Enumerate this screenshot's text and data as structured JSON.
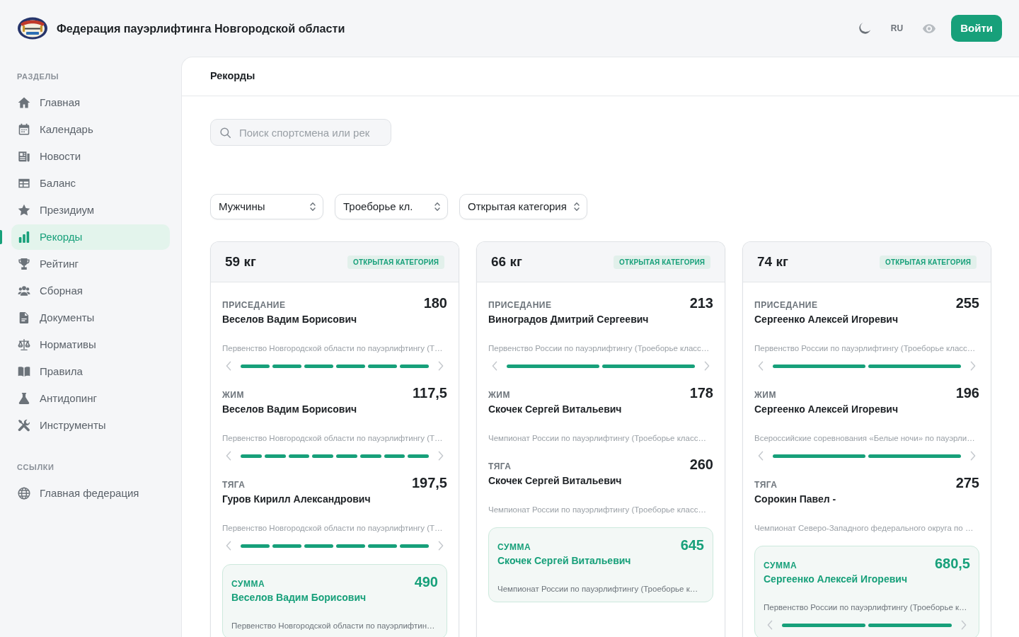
{
  "header": {
    "title": "Федерация пауэрлифтинга Новгородской области",
    "language": "RU",
    "login_button": "Войти"
  },
  "sidebar": {
    "sections": [
      {
        "title": "РАЗДЕЛЫ",
        "items": [
          {
            "label": "Главная",
            "selected": false
          },
          {
            "label": "Календарь",
            "selected": false
          },
          {
            "label": "Новости",
            "selected": false
          },
          {
            "label": "Баланс",
            "selected": false
          },
          {
            "label": "Президиум",
            "selected": false
          },
          {
            "label": "Рекорды",
            "selected": true
          },
          {
            "label": "Рейтинг",
            "selected": false
          },
          {
            "label": "Сборная",
            "selected": false
          },
          {
            "label": "Документы",
            "selected": false
          },
          {
            "label": "Нормативы",
            "selected": false
          },
          {
            "label": "Правила",
            "selected": false
          },
          {
            "label": "Антидопинг",
            "selected": false
          },
          {
            "label": "Инструменты",
            "selected": false
          }
        ]
      },
      {
        "title": "ССЫЛКИ",
        "items": [
          {
            "label": "Главная федерация",
            "selected": false
          }
        ]
      }
    ]
  },
  "page": {
    "title": "Рекорды",
    "search": {
      "placeholder": "Поиск спортсмена или рек"
    },
    "filters": [
      {
        "value": "Мужчины"
      },
      {
        "value": "Троеборье кл."
      },
      {
        "value": "Открытая категория"
      }
    ],
    "cards": [
      {
        "weight_class": "59 кг",
        "badge": "ОТКРЫТАЯ КАТЕГОРИЯ",
        "records": [
          {
            "lift": "ПРИСЕДАНИЕ",
            "result": "180",
            "athlete": "Веселов Вадим Борисович",
            "competition": "Первенство Новгородской области по пауэрлифтингу (Т…",
            "slides": [
              {
                "kind": "bar"
              },
              {
                "kind": "bar"
              },
              {
                "kind": "bar"
              },
              {
                "kind": "bar"
              },
              {
                "kind": "bar"
              },
              {
                "kind": "bar"
              }
            ]
          },
          {
            "lift": "ЖИМ",
            "result": "117,5",
            "athlete": "Веселов Вадим Борисович",
            "competition": "Первенство Новгородской области по пауэрлифтингу (Т…",
            "slides": [
              {
                "kind": "bar"
              },
              {
                "kind": "bar"
              },
              {
                "kind": "bar"
              },
              {
                "kind": "bar"
              },
              {
                "kind": "bar"
              },
              {
                "kind": "bar"
              },
              {
                "kind": "bar"
              },
              {
                "kind": "bar"
              }
            ]
          },
          {
            "lift": "ТЯГА",
            "result": "197,5",
            "athlete": "Гуров Кирилл Александрович",
            "competition": "Первенство Новгородской области по пауэрлифтингу (Т…",
            "slides": [
              {
                "kind": "bar"
              },
              {
                "kind": "bar"
              },
              {
                "kind": "bar"
              },
              {
                "kind": "bar"
              },
              {
                "kind": "bar"
              },
              {
                "kind": "bar"
              }
            ]
          }
        ],
        "total": {
          "label": "СУММА",
          "result": "490",
          "athlete": "Веселов Вадим Борисович",
          "competition": "Первенство Новгородской области по пауэрлифтин…"
        }
      },
      {
        "weight_class": "66 кг",
        "badge": "ОТКРЫТАЯ КАТЕГОРИЯ",
        "records": [
          {
            "lift": "ПРИСЕДАНИЕ",
            "result": "213",
            "athlete": "Виноградов Дмитрий Сергеевич",
            "competition": "Первенство России по пауэрлифтингу (Троеборье класс…",
            "slides": [
              {
                "kind": "bar"
              },
              {
                "kind": "bar"
              }
            ]
          },
          {
            "lift": "ЖИМ",
            "result": "178",
            "athlete": "Скочек Сергей Витальевич",
            "competition": "Чемпионат России по пауэрлифтингу (Троеборье класс…"
          },
          {
            "lift": "ТЯГА",
            "result": "260",
            "athlete": "Скочек Сергей Витальевич",
            "competition": "Чемпионат России по пауэрлифтингу (Троеборье класс…"
          }
        ],
        "total": {
          "label": "СУММА",
          "result": "645",
          "athlete": "Скочек Сергей Витальевич",
          "competition": "Чемпионат России по пауэрлифтингу (Троеборье к…"
        }
      },
      {
        "weight_class": "74 кг",
        "badge": "ОТКРЫТАЯ КАТЕГОРИЯ",
        "records": [
          {
            "lift": "ПРИСЕДАНИЕ",
            "result": "255",
            "athlete": "Сергеенко Алексей Игоревич",
            "competition": "Первенство России по пауэрлифтингу (Троеборье класс…",
            "slides": [
              {
                "kind": "bar"
              },
              {
                "kind": "bar"
              }
            ]
          },
          {
            "lift": "ЖИМ",
            "result": "196",
            "athlete": "Сергеенко Алексей Игоревич",
            "competition": "Всероссийские соревнования «Белые ночи» по пауэрли…",
            "slides": [
              {
                "kind": "bar"
              },
              {
                "kind": "bar"
              }
            ]
          },
          {
            "lift": "ТЯГА",
            "result": "275",
            "athlete": "Сорокин Павел -",
            "competition": "Чемпионат Северо-Западного федерального округа по …"
          }
        ],
        "total": {
          "label": "СУММА",
          "result": "680,5",
          "athlete": "Сергеенко Алексей Игоревич",
          "competition": "Первенство России по пауэрлифтингу (Троеборье к…",
          "slides": [
            {
              "kind": "bar"
            },
            {
              "kind": "bar"
            }
          ]
        }
      }
    ]
  }
}
